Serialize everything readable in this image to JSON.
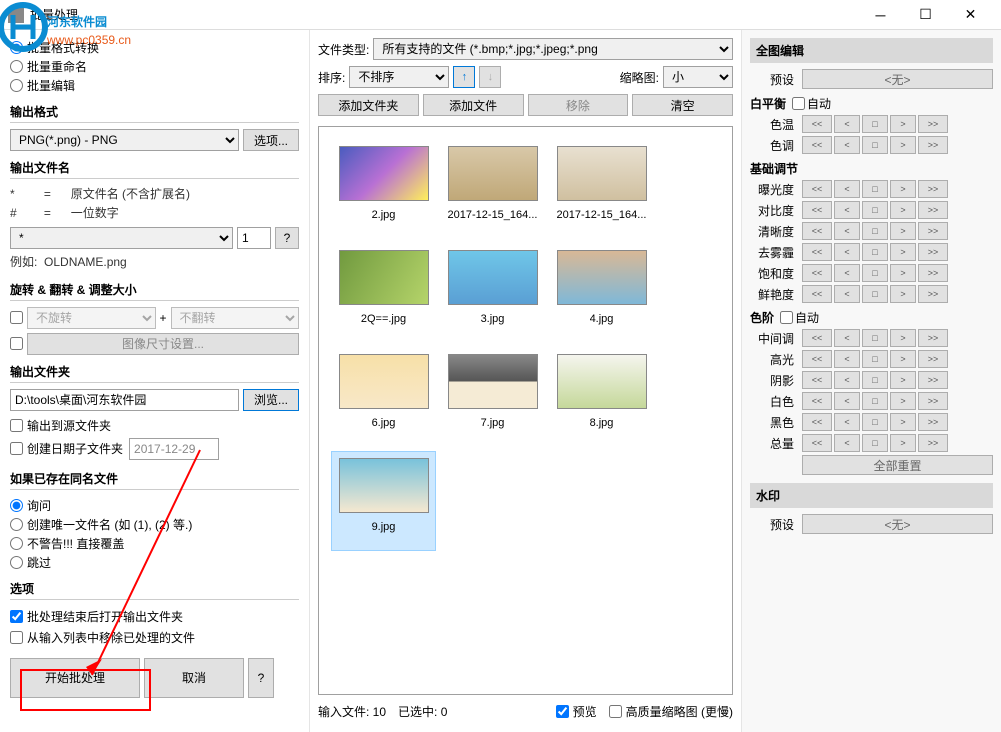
{
  "window": {
    "title": "批量处理"
  },
  "watermark": {
    "text1": "河东软件园",
    "text2": "www.pc0359.cn"
  },
  "mode": {
    "convert": "批量格式转换",
    "rename": "批量重命名",
    "edit": "批量编辑",
    "selected": "convert"
  },
  "output_format": {
    "header": "输出格式",
    "value": "PNG(*.png) - PNG",
    "options_btn": "选项..."
  },
  "output_name": {
    "header": "输出文件名",
    "line1_key": "*",
    "line1_eq": "=",
    "line1_val": "原文件名 (不含扩展名)",
    "line2_key": "#",
    "line2_eq": "=",
    "line2_val": "一位数字",
    "pattern": "*",
    "number": "1",
    "help_btn": "?",
    "example_label": "例如:",
    "example_value": "OLDNAME.png"
  },
  "transform": {
    "header": "旋转 & 翻转 & 调整大小",
    "rotate": "不旋转",
    "plus": "+",
    "flip": "不翻转",
    "resize_btn": "图像尺寸设置..."
  },
  "output_folder": {
    "header": "输出文件夹",
    "path": "D:\\tools\\桌面\\河东软件园",
    "browse_btn": "浏览...",
    "to_source": "输出到源文件夹",
    "date_folder": "创建日期子文件夹",
    "date_value": "2017-12-29"
  },
  "exists": {
    "header": "如果已存在同名文件",
    "ask": "询问",
    "unique": "创建唯一文件名 (如 (1), (2) 等.)",
    "overwrite": "不警告!!! 直接覆盖",
    "skip": "跳过",
    "selected": "ask"
  },
  "options": {
    "header": "选项",
    "open_after": "批处理结束后打开输出文件夹",
    "remove_done": "从输入列表中移除已处理的文件"
  },
  "buttons": {
    "start": "开始批处理",
    "cancel": "取消",
    "help": "?"
  },
  "center": {
    "filetype_label": "文件类型:",
    "filetype_value": "所有支持的文件 (*.bmp;*.jpg;*.jpeg;*.png",
    "sort_label": "排序:",
    "sort_value": "不排序",
    "thumb_label": "缩略图:",
    "thumb_value": "小",
    "add_folder": "添加文件夹",
    "add_file": "添加文件",
    "remove": "移除",
    "clear": "清空",
    "status_input": "输入文件: 10",
    "status_selected": "已选中: 0",
    "preview": "预览",
    "hq_thumb": "高质量缩略图 (更慢)"
  },
  "thumbs": [
    {
      "label": "2.jpg",
      "bg": "tbg1"
    },
    {
      "label": "2017-12-15_164...",
      "bg": "tbg2"
    },
    {
      "label": "2017-12-15_164...",
      "bg": "tbg3"
    },
    {
      "label": "2Q==.jpg",
      "bg": "tbg4"
    },
    {
      "label": "3.jpg",
      "bg": "tbg5"
    },
    {
      "label": "4.jpg",
      "bg": "tbg6"
    },
    {
      "label": "6.jpg",
      "bg": "tbg7"
    },
    {
      "label": "7.jpg",
      "bg": "tbg8"
    },
    {
      "label": "8.jpg",
      "bg": "tbg9"
    },
    {
      "label": "9.jpg",
      "bg": "tbg10",
      "selected": true
    }
  ],
  "right": {
    "full_edit": "全图编辑",
    "preset_label": "预设",
    "preset_none": "<无>",
    "wb_header": "白平衡",
    "auto": "自动",
    "temp": "色温",
    "tint": "色调",
    "basic_header": "基础调节",
    "exposure": "曝光度",
    "contrast": "对比度",
    "clarity": "清晰度",
    "dehaze": "去雾霾",
    "saturation": "饱和度",
    "vibrance": "鲜艳度",
    "levels_header": "色阶",
    "mid": "中间调",
    "highlight": "高光",
    "shadow": "阴影",
    "white": "白色",
    "black": "黑色",
    "total": "总量",
    "reset_all": "全部重置",
    "watermark_header": "水印"
  },
  "steppers": {
    "ll": "<<",
    "l": "<",
    "c": "□",
    "r": ">",
    "rr": ">>"
  }
}
